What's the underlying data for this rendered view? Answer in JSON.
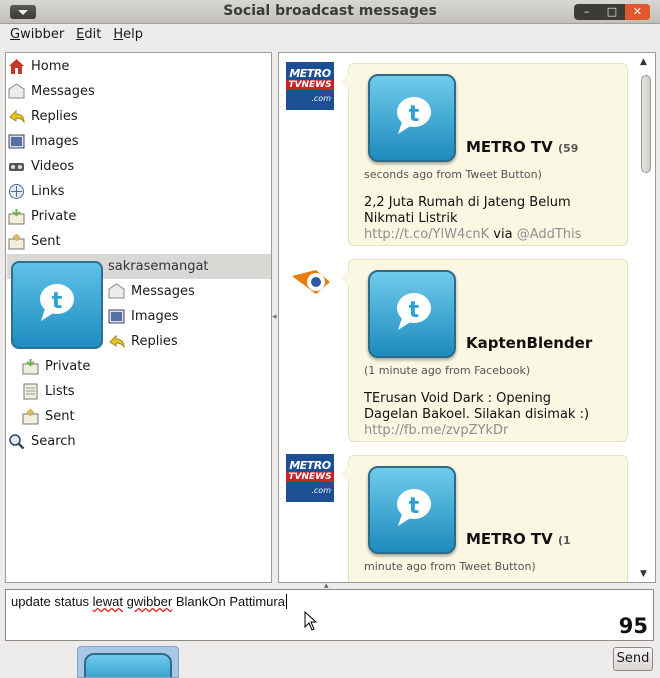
{
  "window": {
    "title": "Social broadcast messages"
  },
  "menu": [
    {
      "pre": "",
      "key": "G",
      "post": "wibber"
    },
    {
      "pre": "",
      "key": "E",
      "post": "dit"
    },
    {
      "pre": "",
      "key": "H",
      "post": "elp"
    }
  ],
  "sidebar": {
    "items": [
      {
        "label": "Home",
        "icon": "home-icon",
        "color": "#c0392b"
      },
      {
        "label": "Messages",
        "icon": "messages-icon",
        "color": "#c8c8c8"
      },
      {
        "label": "Replies",
        "icon": "replies-icon",
        "color": "#e7c52a"
      },
      {
        "label": "Images",
        "icon": "images-icon",
        "color": "#5470a6"
      },
      {
        "label": "Videos",
        "icon": "videos-icon",
        "color": "#555555"
      },
      {
        "label": "Links",
        "icon": "links-icon",
        "color": "#4a6a9c"
      },
      {
        "label": "Private",
        "icon": "private-icon",
        "color": "#6fb24a"
      },
      {
        "label": "Sent",
        "icon": "sent-icon",
        "color": "#d9b64a"
      }
    ],
    "account": {
      "name": "sakrasemangat",
      "items": [
        {
          "label": "Messages",
          "icon": "messages-icon"
        },
        {
          "label": "Images",
          "icon": "images-icon"
        },
        {
          "label": "Replies",
          "icon": "replies-icon"
        }
      ],
      "sub_items": [
        {
          "label": "Private",
          "icon": "private-icon"
        },
        {
          "label": "Lists",
          "icon": "lists-icon"
        },
        {
          "label": "Sent",
          "icon": "sent-icon"
        }
      ]
    },
    "search": {
      "label": "Search",
      "icon": "search-icon"
    }
  },
  "messages": [
    {
      "author": "METRO TV",
      "meta_open": "(59",
      "meta_rest": "seconds ago from Tweet Button)",
      "text": "2,2 Juta Rumah di Jateng Belum Nikmati Listrik",
      "link": "http://t.co/YlW4cnK",
      "via": "via",
      "mention": "@AddThis",
      "thumb": "metro"
    },
    {
      "author": "KaptenBlender",
      "meta_open": "(",
      "meta_rest": "1 minute ago from Facebook)",
      "text": "TErusan Void Dark : Opening Dagelan Bakoel. Silakan disimak :)",
      "link": "http://fb.me/zvpZYkDr",
      "thumb": "blender"
    },
    {
      "author": "METRO TV",
      "meta_open": "(1",
      "meta_rest": "minute ago from Tweet Button)",
      "thumb": "metro"
    }
  ],
  "input": {
    "before": "update status ",
    "w1": "lewat",
    "sp1": " ",
    "w2": "gwibber",
    "sp2": " ",
    "w3": "BlankOn",
    "sp3": " ",
    "w4": "Pattimura",
    "char_count": "95"
  },
  "buttons": {
    "send": "Send"
  },
  "logos": {
    "metro_line1": "METRO",
    "metro_line2": "TVNEWS",
    "metro_line3": ".com"
  }
}
